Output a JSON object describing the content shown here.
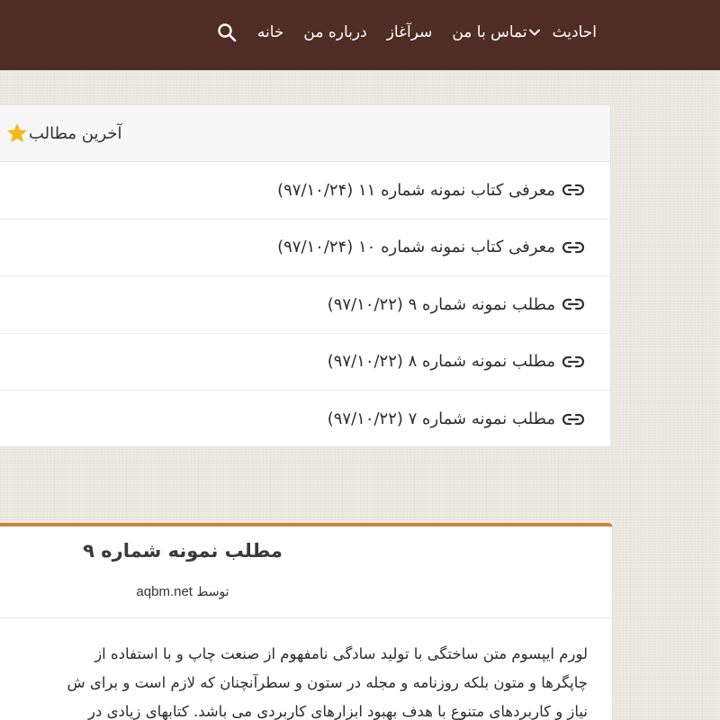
{
  "colors": {
    "topbar": "#4f2d25",
    "accent_border": "#c8883a",
    "star": "#f5b71a"
  },
  "nav": {
    "search_icon": "search-icon",
    "items": [
      "خانه",
      "درباره من",
      "سرآغاز",
      "تماس با من"
    ],
    "dropdown_label": "احادیث",
    "dropdown_icon": "chevron-down-icon"
  },
  "latest": {
    "title": "آخرین مطالب",
    "title_icon": "star-icon",
    "row_icon": "link-icon",
    "items": [
      "معرفی کتاب نمونه شماره ۱۱ (۹۷/۱۰/۲۴)",
      "معرفی کتاب نمونه شماره ۱۰ (۹۷/۱۰/۲۴)",
      "مطلب نمونه شماره ۹ (۹۷/۱۰/۲۲)",
      "مطلب نمونه شماره ۸ (۹۷/۱۰/۲۲)",
      "مطلب نمونه شماره ۷ (۹۷/۱۰/۲۲)"
    ]
  },
  "post": {
    "title": "مطلب نمونه شماره ۹",
    "by_label": "توسط",
    "author": "aqbm.net",
    "body_lines": [
      "لورم ایپسوم متن ساختگی با تولید سادگی نامفهوم از صنعت چاپ و با استفاده از",
      "چاپگرها و متون بلکه روزنامه و مجله در ستون و سطرآنچنان که لازم است و برای ش",
      "نیاز و کاربردهای متنوع با هدف بهبود ابزارهای کاربردی می باشد. کتابهای زیادی در"
    ]
  }
}
